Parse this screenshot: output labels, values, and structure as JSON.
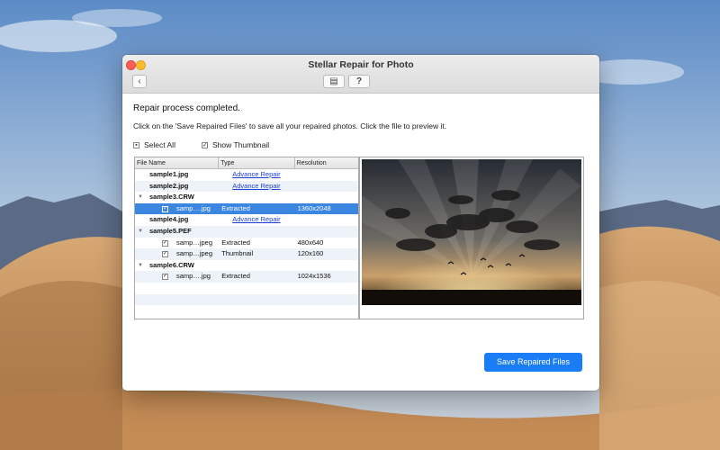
{
  "window": {
    "title": "Stellar Repair for Photo",
    "back_glyph": "‹",
    "save_glyph": "▤",
    "help_label": "?"
  },
  "content": {
    "heading": "Repair process completed.",
    "instruction": "Click on the 'Save Repaired Files' to save all your repaired photos. Click the file to preview it.",
    "select_all_label": "Select All",
    "show_thumbnail_label": "Show Thumbnail",
    "show_thumbnail_checked": true
  },
  "table": {
    "columns": [
      "File Name",
      "Type",
      "Resolution"
    ],
    "rows": [
      {
        "name": "sample1.jpg",
        "type": "Advance Repair",
        "resolution": ""
      },
      {
        "name": "sample2.jpg",
        "type": "Advance Repair",
        "resolution": ""
      },
      {
        "name": "sample3.CRW",
        "type": "",
        "resolution": ""
      },
      {
        "name": "samp….jpg",
        "type": "Extracted",
        "resolution": "1360x2048"
      },
      {
        "name": "sample4.jpg",
        "type": "Advance Repair",
        "resolution": ""
      },
      {
        "name": "sample5.PEF",
        "type": "",
        "resolution": ""
      },
      {
        "name": "samp…jpeg",
        "type": "Extracted",
        "resolution": "480x640"
      },
      {
        "name": "samp…jpeg",
        "type": "Thumbnail",
        "resolution": "120x160"
      },
      {
        "name": "sample6.CRW",
        "type": "",
        "resolution": ""
      },
      {
        "name": "samp….jpg",
        "type": "Extracted",
        "resolution": "1024x1536"
      }
    ]
  },
  "save_button_label": "Save Repaired Files",
  "colors": {
    "accent": "#1a7df5",
    "selection": "#3b86e0",
    "link": "#1a3fd8"
  },
  "icons": [
    "back-icon",
    "save-icon",
    "help-icon",
    "checkbox-icon",
    "disclosure-icon"
  ]
}
